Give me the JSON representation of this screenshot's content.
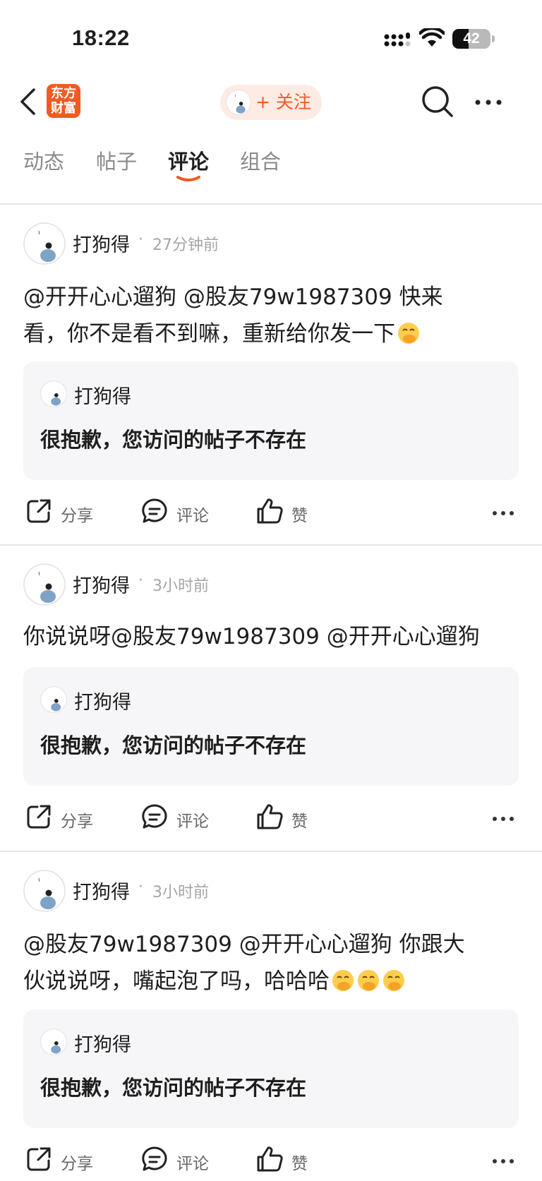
{
  "status_bar": {
    "time": "18:22",
    "battery": "42",
    "battery_level": 0.42
  },
  "nav": {
    "logo_text_line1": "东方",
    "logo_text_line2": "财富",
    "follow_label": "+ 关注"
  },
  "tabs": [
    {
      "label": "动态",
      "active": false
    },
    {
      "label": "帖子",
      "active": false
    },
    {
      "label": "评论",
      "active": true
    },
    {
      "label": "组合",
      "active": false
    }
  ],
  "posts": [
    {
      "author": "打狗得",
      "time": "27分钟前",
      "text_line1": "@开开心心遛狗 @股友79w1987309 快来",
      "text_line2": "看，你不是看不到嘛，重新给你发一下",
      "emoji_count": 1,
      "quote": {
        "author": "打狗得",
        "text": "很抱歉，您访问的帖子不存在"
      }
    },
    {
      "author": "打狗得",
      "time": "3小时前",
      "text_line1": "你说说呀@股友79w1987309 @开开心心遛狗",
      "text_line2": "",
      "emoji_count": 0,
      "quote": {
        "author": "打狗得",
        "text": "很抱歉，您访问的帖子不存在"
      }
    },
    {
      "author": "打狗得",
      "time": "3小时前",
      "text_line1": "@股友79w1987309 @开开心心遛狗 你跟大",
      "text_line2": "伙说说呀，嘴起泡了吗，哈哈哈",
      "emoji_count": 3,
      "quote": {
        "author": "打狗得",
        "text": "很抱歉，您访问的帖子不存在"
      }
    }
  ],
  "actions": {
    "share": "分享",
    "comment": "评论",
    "like": "赞"
  },
  "icons": {
    "back": "chevron-left-icon",
    "search": "search-icon",
    "more": "more-horizontal-icon",
    "share": "share-icon",
    "comment": "comment-icon",
    "like": "thumbs-up-icon",
    "emoji": "hand-over-mouth-emoji"
  },
  "colors": {
    "accent": "#f25a22",
    "follow_bg": "#fdebe4",
    "card_bg": "#f6f6f8",
    "muted": "#a5a5a5"
  }
}
